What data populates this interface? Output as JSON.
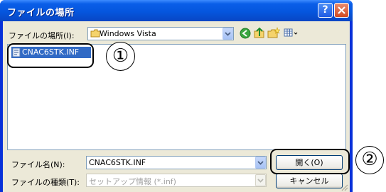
{
  "window": {
    "title": "ファイルの場所",
    "help_label": "?"
  },
  "lookin": {
    "label": "ファイルの場所(I):",
    "value": "Windows Vista"
  },
  "files": [
    {
      "name": "CNAC6STK.INF"
    }
  ],
  "filename": {
    "label": "ファイル名(N):",
    "value": "CNAC6STK.INF"
  },
  "filetype": {
    "label": "ファイルの種類(T):",
    "value": "セットアップ情報 (*.inf)"
  },
  "buttons": {
    "open": "開く(O)",
    "cancel": "キャンセル"
  },
  "annotations": {
    "one": "①",
    "two": "②"
  },
  "colors": {
    "titlebar": "#0556de",
    "selection": "#316ac5",
    "dialog_bg": "#ece9d8"
  }
}
